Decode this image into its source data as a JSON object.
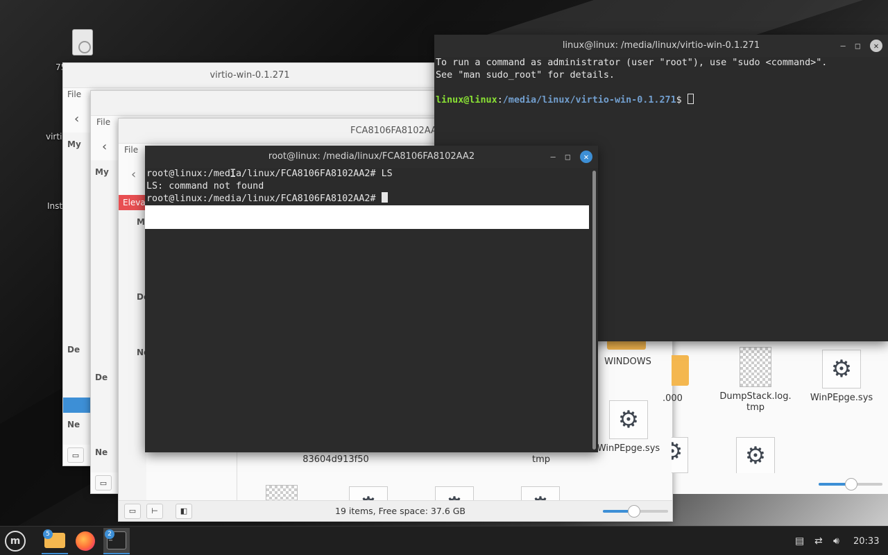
{
  "desktop": {
    "icon_labels": [
      "75",
      "virti",
      "Inst"
    ]
  },
  "fm_back": {
    "title": "virtio-win-0.1.271",
    "menu": "File",
    "sidebar": [
      "My",
      "De",
      "Ne"
    ]
  },
  "fm_mid": {
    "menu": "File",
    "sidebar": [
      "My",
      "De",
      "Ne"
    ]
  },
  "fm_front": {
    "title": "FCA8106FA8102AA2",
    "menu": "File",
    "elevated": "Eleva",
    "sidebar": [
      "My",
      "De",
      "Ne"
    ],
    "status": "19 items, Free space: 37.6 GB",
    "files": [
      {
        "label": "WINDOWS",
        "kind": "folder"
      },
      {
        ".000": ".000"
      },
      {
        "label": "DumpStack.log.tmp",
        "kind": "checker"
      },
      {
        "label": "WinPEpge.sys",
        "kind": "gear"
      },
      {
        "label": "WinPEpge.sys",
        "kind": "gear"
      },
      {
        "label": "83604d913f50",
        "kind": "partial"
      },
      {
        "label": "tmp",
        "kind": "partial"
      }
    ],
    "labels": {
      "windows": "WINDOWS",
      "partial_000": ".000",
      "dumpstack_1": "DumpStack.log.",
      "dumpstack_2": "tmp",
      "winpe_1": "WinPEpge.sys",
      "winpe_2": "WinPEpge.sys",
      "hash": "83604d913f50",
      "tmp": "tmp"
    }
  },
  "term_user": {
    "title": "linux@linux: /media/linux/virtio-win-0.1.271",
    "line1": "To run a command as administrator (user \"root\"), use \"sudo <command>\".",
    "line2": "See \"man sudo_root\" for details.",
    "prompt_user": "linux@linux",
    "prompt_sep": ":",
    "prompt_path": "/media/linux/virtio-win-0.1.271",
    "prompt_end": "$ "
  },
  "term_root": {
    "title": "root@linux: /media/linux/FCA8106FA8102AA2",
    "line1": "root@linux:/media/linux/FCA8106FA8102AA2# LS",
    "line2": "LS: command not found",
    "line3": "root@linux:/media/linux/FCA8106FA8102AA2# "
  },
  "taskbar": {
    "files_badge": "5",
    "terminal_badge": "2",
    "clock": "20:33"
  },
  "icons": {
    "menu": "mint-logo-icon",
    "files": "folder-icon",
    "browser": "firefox-icon",
    "terminal": "terminal-icon",
    "tray": [
      "notes-icon",
      "network-icon",
      "volume-icon"
    ]
  },
  "colors": {
    "accent": "#3d8fd6",
    "elevated": "#e84f52",
    "prompt_user": "#8ae234",
    "prompt_path": "#729fcf"
  }
}
